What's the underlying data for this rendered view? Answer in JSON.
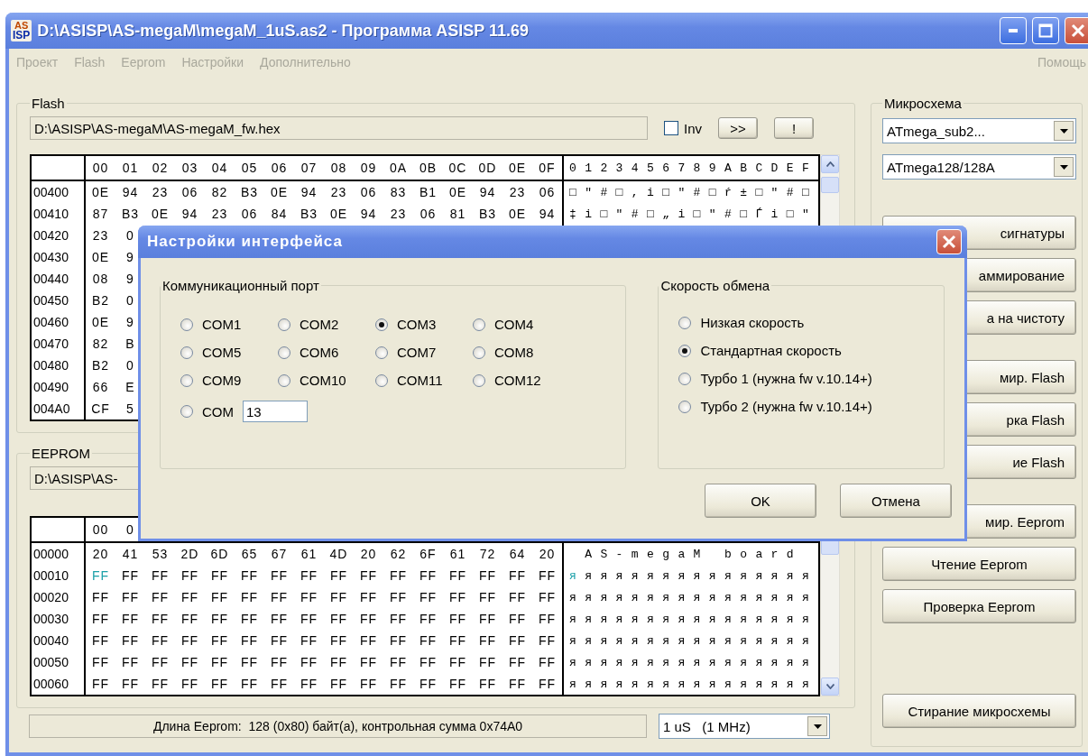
{
  "window": {
    "logo": {
      "top": "AS",
      "bottom": "ISP"
    },
    "title": "D:\\ASISP\\AS-megaM\\megaM_1uS.as2 - Программа ASISP 11.69"
  },
  "menu": [
    {
      "label": "Проект",
      "disabled": true
    },
    {
      "label": "Flash",
      "disabled": true
    },
    {
      "label": "Eeprom",
      "disabled": true
    },
    {
      "label": "Настройки",
      "disabled": true
    },
    {
      "label": "Дополнительно",
      "disabled": true
    }
  ],
  "help_menu": {
    "label": "Помощь",
    "disabled": true
  },
  "flash": {
    "title": "Flash",
    "path": "D:\\ASISP\\AS-megaM\\AS-megaM_fw.hex",
    "inv": {
      "label": "Inv",
      "checked": false
    },
    "buttons": [
      ">>",
      "!"
    ],
    "table": {
      "columns": [
        "00",
        "01",
        "02",
        "03",
        "04",
        "05",
        "06",
        "07",
        "08",
        "09",
        "0A",
        "0B",
        "0C",
        "0D",
        "0E",
        "0F"
      ],
      "ascii_header": "0123456789ABCDEF",
      "rows": [
        {
          "address": "00400",
          "bytes": [
            "0E",
            "94",
            "23",
            "06",
            "82",
            "B3",
            "0E",
            "94",
            "23",
            "06",
            "83",
            "B1",
            "0E",
            "94",
            "23",
            "06"
          ],
          "ascii": "□\"#□,i□\"#□ŕ±□\"#□"
        },
        {
          "address": "00410",
          "bytes": [
            "87",
            "B3",
            "0E",
            "94",
            "23",
            "06",
            "84",
            "B3",
            "0E",
            "94",
            "23",
            "06",
            "81",
            "B3",
            "0E",
            "94"
          ],
          "ascii": "‡i□\"#□„i□\"#□Ѓi□\""
        },
        {
          "address": "00420",
          "bytes": [
            "23",
            "0"
          ]
        },
        {
          "address": "00430",
          "bytes": [
            "0E",
            "9"
          ]
        },
        {
          "address": "00440",
          "bytes": [
            "08",
            "9"
          ]
        },
        {
          "address": "00450",
          "bytes": [
            "B2",
            "0"
          ]
        },
        {
          "address": "00460",
          "bytes": [
            "0E",
            "9"
          ]
        },
        {
          "address": "00470",
          "bytes": [
            "82",
            "B"
          ]
        },
        {
          "address": "00480",
          "bytes": [
            "B2",
            "0"
          ]
        },
        {
          "address": "00490",
          "bytes": [
            "66",
            "E"
          ]
        },
        {
          "address": "004A0",
          "bytes": [
            "CF",
            "5"
          ]
        }
      ]
    }
  },
  "eeprom": {
    "title": "EEPROM",
    "path": "D:\\ASISP\\AS-",
    "table": {
      "columns": [
        "00",
        "0"
      ],
      "rows": [
        {
          "address": "00000",
          "bytes": [
            "20",
            "41",
            "53",
            "2D",
            "6D",
            "65",
            "67",
            "61",
            "4D",
            "20",
            "62",
            "6F",
            "61",
            "72",
            "64",
            "20"
          ],
          "ascii": " AS-megaM board ",
          "cursor": false
        },
        {
          "address": "00010",
          "bytes": [
            "FF",
            "FF",
            "FF",
            "FF",
            "FF",
            "FF",
            "FF",
            "FF",
            "FF",
            "FF",
            "FF",
            "FF",
            "FF",
            "FF",
            "FF",
            "FF"
          ],
          "ascii": "яяяяяяяяяяяяяяяя",
          "cursor": true
        },
        {
          "address": "00020",
          "bytes": [
            "FF",
            "FF",
            "FF",
            "FF",
            "FF",
            "FF",
            "FF",
            "FF",
            "FF",
            "FF",
            "FF",
            "FF",
            "FF",
            "FF",
            "FF",
            "FF"
          ],
          "ascii": "яяяяяяяяяяяяяяяя",
          "cursor": false
        },
        {
          "address": "00030",
          "bytes": [
            "FF",
            "FF",
            "FF",
            "FF",
            "FF",
            "FF",
            "FF",
            "FF",
            "FF",
            "FF",
            "FF",
            "FF",
            "FF",
            "FF",
            "FF",
            "FF"
          ],
          "ascii": "яяяяяяяяяяяяяяяя",
          "cursor": false
        },
        {
          "address": "00040",
          "bytes": [
            "FF",
            "FF",
            "FF",
            "FF",
            "FF",
            "FF",
            "FF",
            "FF",
            "FF",
            "FF",
            "FF",
            "FF",
            "FF",
            "FF",
            "FF",
            "FF"
          ],
          "ascii": "яяяяяяяяяяяяяяяя",
          "cursor": false
        },
        {
          "address": "00050",
          "bytes": [
            "FF",
            "FF",
            "FF",
            "FF",
            "FF",
            "FF",
            "FF",
            "FF",
            "FF",
            "FF",
            "FF",
            "FF",
            "FF",
            "FF",
            "FF",
            "FF"
          ],
          "ascii": "яяяяяяяяяяяяяяяя",
          "cursor": false
        },
        {
          "address": "00060",
          "bytes": [
            "FF",
            "FF",
            "FF",
            "FF",
            "FF",
            "FF",
            "FF",
            "FF",
            "FF",
            "FF",
            "FF",
            "FF",
            "FF",
            "FF",
            "FF",
            "FF"
          ],
          "ascii": "яяяяяяяяяяяяяяяя",
          "cursor": false
        }
      ]
    }
  },
  "status": {
    "text": "Длина Eeprom:  128 (0x80) байт(а), контрольная сумма 0x74A0",
    "clock": "1 uS   (1 MHz)"
  },
  "chip": {
    "title": "Микросхема",
    "selects": [
      "ATmega_sub2...",
      "ATmega128/128A"
    ],
    "button_groups": [
      [
        {
          "label": "сигнатуры",
          "kind": "covered"
        },
        {
          "label": "аммирование",
          "kind": "covered"
        },
        {
          "label": "а на чистоту",
          "kind": "covered"
        }
      ],
      [
        {
          "label": "мир. Flash",
          "kind": "covered"
        },
        {
          "label": "рка Flash",
          "kind": "covered"
        },
        {
          "label": "ие Flash",
          "kind": "covered"
        }
      ],
      [
        {
          "label": "мир. Eeprom",
          "kind": "covered"
        },
        {
          "label": "Чтение Eeprom",
          "kind": "full"
        },
        {
          "label": "Проверка Eeprom",
          "kind": "full"
        }
      ],
      [
        {
          "label": "Стирание микросхемы",
          "kind": "full"
        }
      ]
    ]
  },
  "dialog": {
    "title": "Настройки интерфейса",
    "port_group": {
      "title": "Коммуникационный порт",
      "ports": [
        {
          "label": "COM1",
          "selected": false
        },
        {
          "label": "COM2",
          "selected": false
        },
        {
          "label": "COM3",
          "selected": true
        },
        {
          "label": "COM4",
          "selected": false
        },
        {
          "label": "COM5",
          "selected": false
        },
        {
          "label": "COM6",
          "selected": false
        },
        {
          "label": "COM7",
          "selected": false
        },
        {
          "label": "COM8",
          "selected": false
        },
        {
          "label": "COM9",
          "selected": false
        },
        {
          "label": "COM10",
          "selected": false
        },
        {
          "label": "COM11",
          "selected": false
        },
        {
          "label": "COM12",
          "selected": false
        }
      ],
      "custom_port": {
        "label": "COM",
        "value": "13",
        "selected": false
      }
    },
    "speed_group": {
      "title": "Скорость обмена",
      "options": [
        {
          "label": "Низкая скорость",
          "selected": false
        },
        {
          "label": "Стандартная скорость",
          "selected": true
        },
        {
          "label": "Турбо 1 (нужна fw v.10.14+)",
          "selected": false
        },
        {
          "label": "Турбо 2 (нужна fw v.10.14+)",
          "selected": false
        }
      ]
    },
    "buttons": [
      "OK",
      "Отмена"
    ]
  }
}
